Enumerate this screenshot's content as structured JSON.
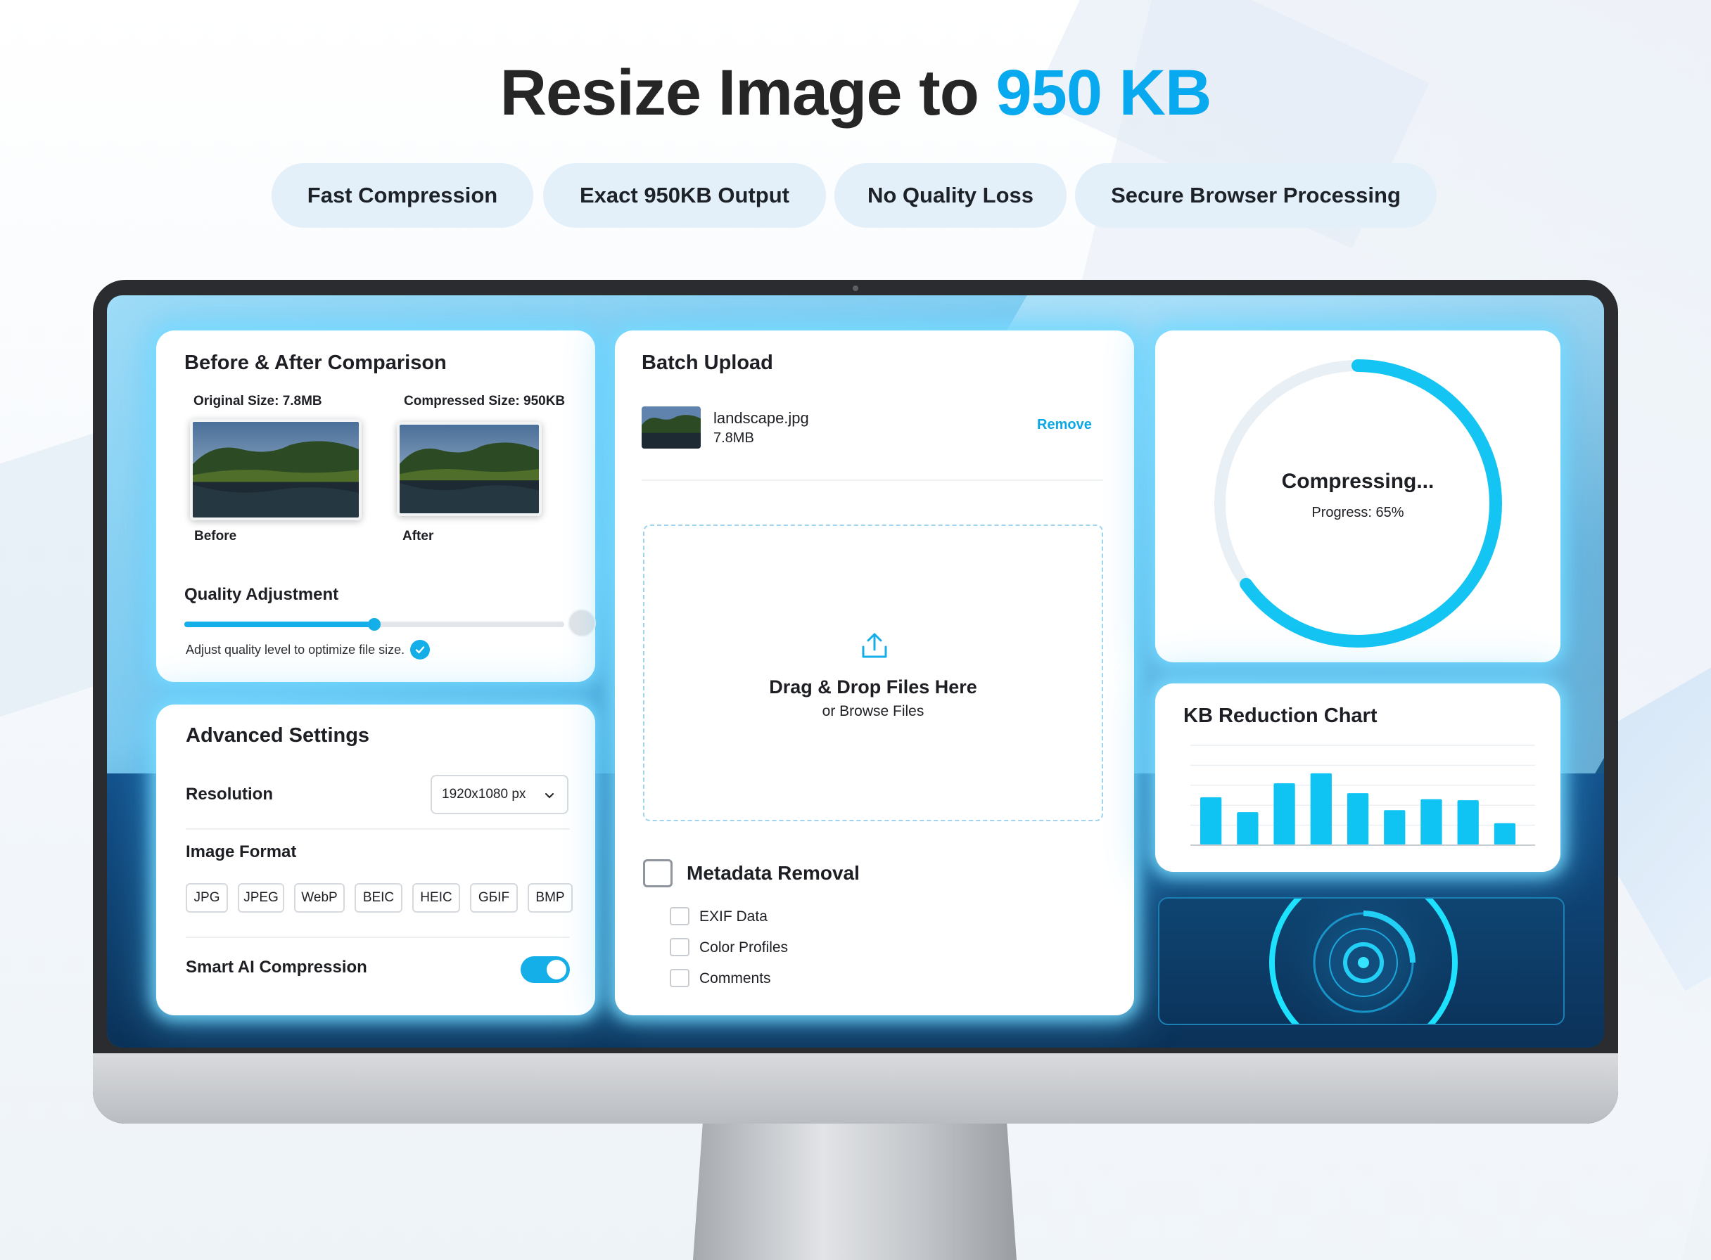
{
  "hero": {
    "title_prefix": "Resize Image to ",
    "title_accent": "950 KB"
  },
  "features": [
    "Fast Compression",
    "Exact 950KB Output",
    "No Quality Loss",
    "Secure Browser Processing"
  ],
  "comparison": {
    "title": "Before & After Comparison",
    "original_label": "Original Size: 7.8MB",
    "compressed_label": "Compressed Size: 950KB",
    "before_caption": "Before",
    "after_caption": "After",
    "quality_title": "Quality Adjustment",
    "quality_level": 0.5,
    "quality_hint": "Adjust quality level to optimize file size."
  },
  "settings": {
    "title": "Advanced Settings",
    "resolution_label": "Resolution",
    "resolution_value": "1920x1080 px",
    "format_label": "Image Format",
    "formats": [
      "JPG",
      "JPEG",
      "WebP",
      "BEIC",
      "HEIC",
      "GБIF",
      "BMP"
    ],
    "smart_label": "Smart AI Compression",
    "smart_enabled": true
  },
  "upload": {
    "title": "Batch Upload",
    "file_name": "landscape.jpg",
    "file_size": "7.8MB",
    "remove_label": "Remove",
    "drop_title": "Drag & Drop Files Here",
    "drop_sub": "or Browse Files",
    "metadata_title": "Metadata Removal",
    "metadata_options": [
      "EXIF Data",
      "Color Profiles",
      "Comments"
    ]
  },
  "progress": {
    "title": "Compressing...",
    "label": "Progress: 65%",
    "value": 65
  },
  "chart_data": {
    "type": "bar",
    "title": "KB Reduction Chart",
    "values": [
      48,
      33,
      62,
      72,
      52,
      35,
      46,
      45,
      22
    ],
    "ylim": [
      0,
      100
    ],
    "grid": true,
    "accent": "#0fc4f2"
  },
  "colors": {
    "accent": "#08a9ee",
    "glow": "#78dcff"
  }
}
